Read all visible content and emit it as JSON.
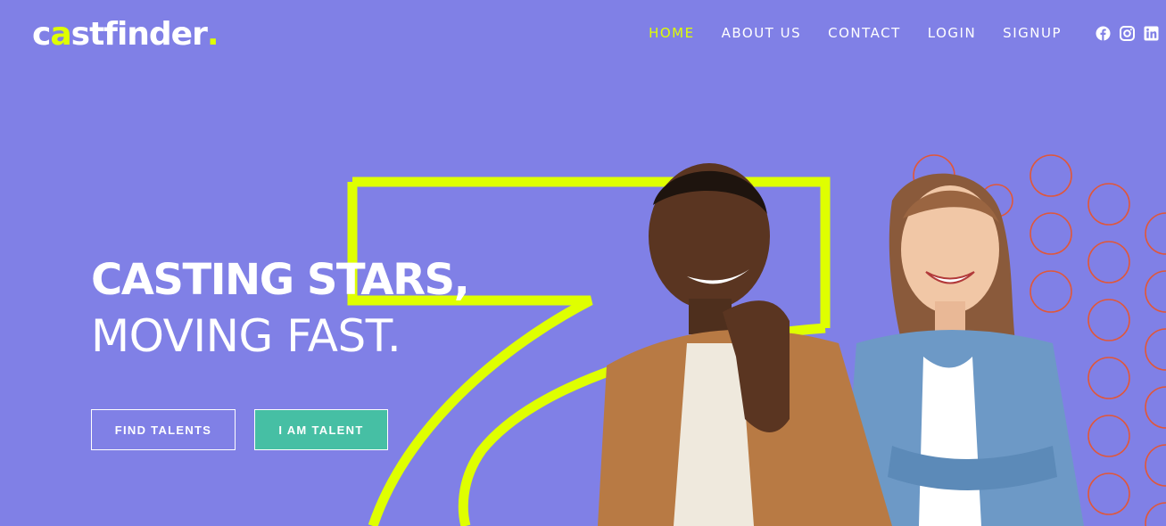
{
  "brand": {
    "logo_prefix": "c",
    "logo_accent": "a",
    "logo_suffix": "stfinder",
    "logo_dot": ".",
    "accent_color": "#dfff00",
    "background_color": "#8080e6",
    "secondary_color": "#46bfa4",
    "circle_color": "#e0573a"
  },
  "nav": {
    "items": [
      {
        "label": "HOME",
        "active": true
      },
      {
        "label": "ABOUT US",
        "active": false
      },
      {
        "label": "CONTACT",
        "active": false
      },
      {
        "label": "LOGIN",
        "active": false
      },
      {
        "label": "SIGNUP",
        "active": false
      }
    ]
  },
  "social": [
    "facebook-icon",
    "instagram-icon",
    "linkedin-icon"
  ],
  "hero": {
    "title_line_1": "CASTING STARS,",
    "title_line_2": "MOVING FAST.",
    "buttons": {
      "find_talents": "FIND TALENTS",
      "i_am_talent": "I AM TALENT"
    }
  }
}
